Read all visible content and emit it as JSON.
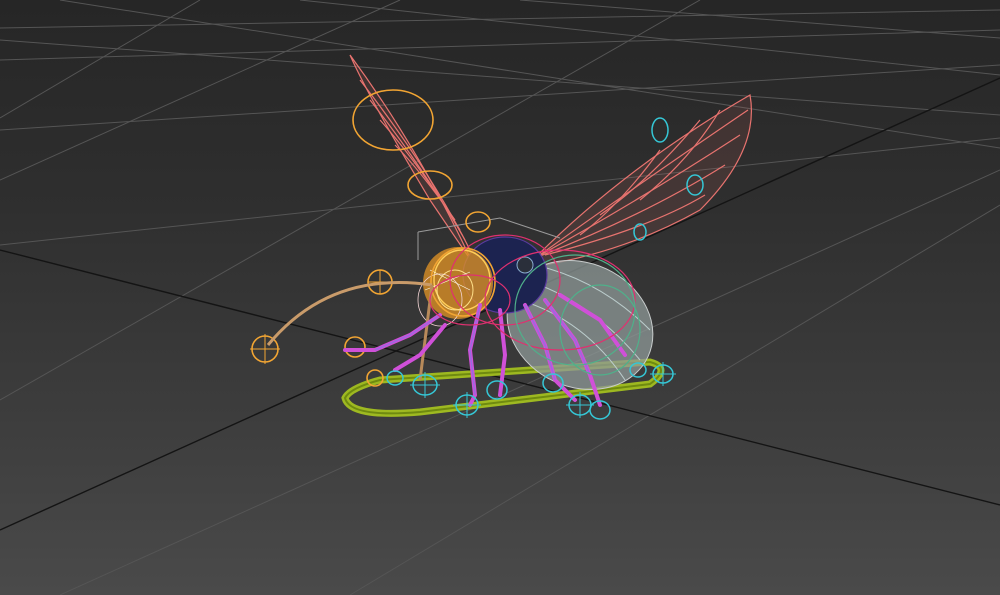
{
  "viewport": {
    "background_top": "#262626",
    "background_bottom": "#4a4a4a",
    "grid_color": "#555555",
    "grid_axis_color": "#111111",
    "model": "bee-character-rig",
    "colors": {
      "wing_wireframe": "#e8736f",
      "head_controls": "#f2a533",
      "body_mesh": "#9aa7a3",
      "leg_mesh": "#d050d8",
      "bone_controls": "#35c7d6",
      "root_control": "#a8c71e",
      "antenna": "#c99b6a",
      "thorax": "#1c2350"
    }
  }
}
